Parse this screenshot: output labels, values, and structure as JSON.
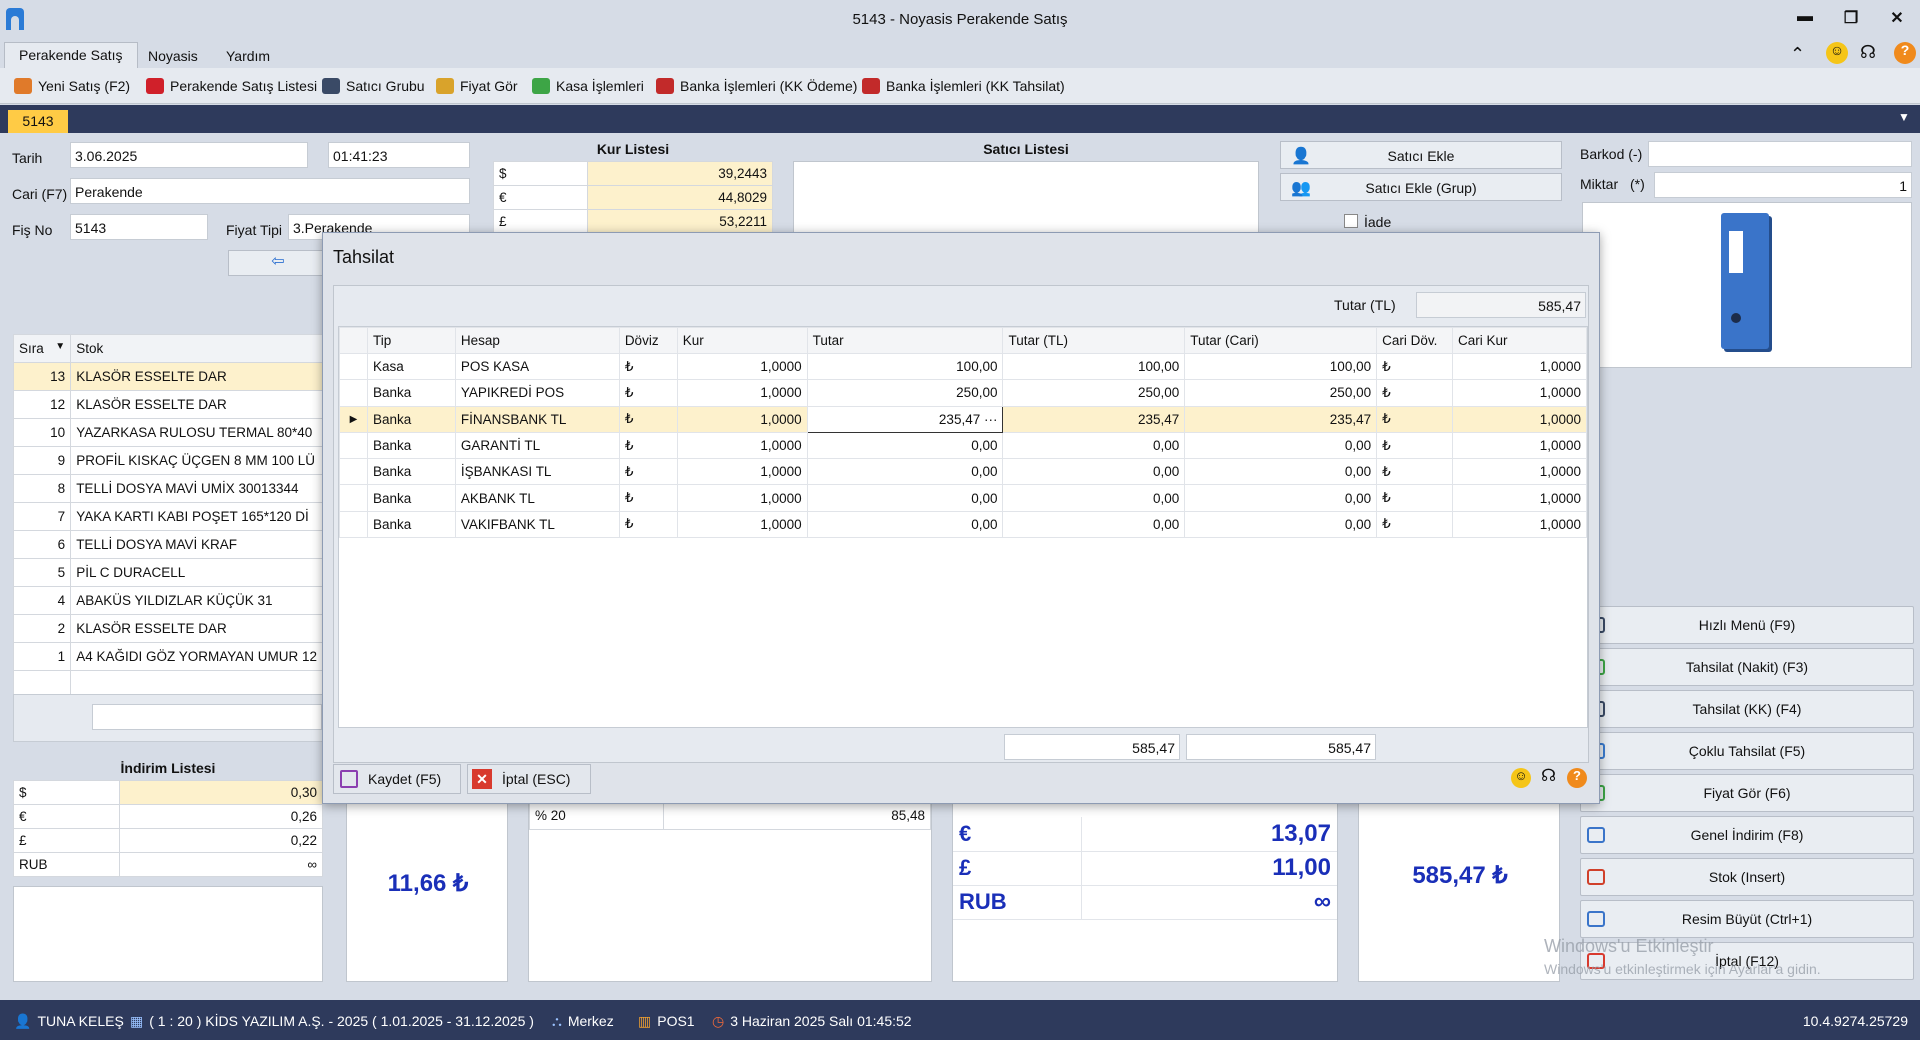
{
  "window": {
    "title": "5143 - Noyasis Perakende Satış",
    "minimize": "▬",
    "restore": "❐",
    "close": "✕"
  },
  "menu_tabs": [
    "Perakende Satış",
    "Noyasis",
    "Yardım"
  ],
  "ribbon": [
    {
      "label": "Yeni Satış (F2)",
      "icon": "new-sale-icon",
      "color": "#e07a2a"
    },
    {
      "label": "Perakende Satış Listesi",
      "icon": "cart-icon",
      "color": "#d0202a"
    },
    {
      "label": "Satıcı Grubu",
      "icon": "user-group-icon",
      "color": "#3a4a66"
    },
    {
      "label": "Fiyat Gör",
      "icon": "price-icon",
      "color": "#d9a32b"
    },
    {
      "label": "Kasa İşlemleri",
      "icon": "cash-icon",
      "color": "#3da546"
    },
    {
      "label": "Banka İşlemleri (KK Ödeme)",
      "icon": "card-icon",
      "color": "#c22a2a"
    },
    {
      "label": "Banka İşlemleri (KK Tahsilat)",
      "icon": "card-icon",
      "color": "#c22a2a"
    }
  ],
  "doc_tab": "5143",
  "form": {
    "tarih_label": "Tarih",
    "tarih": "3.06.2025",
    "saat": "01:41:23",
    "cari_label": "Cari (F7)",
    "cari": "Perakende",
    "fis_label": "Fiş No",
    "fis": "5143",
    "fiyat_tipi_label": "Fiyat Tipi",
    "fiyat_tipi": "3.Perakende"
  },
  "kur_listesi": {
    "title": "Kur Listesi",
    "rows": [
      [
        "$",
        "39,2443"
      ],
      [
        "€",
        "44,8029"
      ],
      [
        "£",
        "53,2211"
      ]
    ]
  },
  "satici_listesi": {
    "title": "Satıcı Listesi"
  },
  "satici_buttons": {
    "ekle": "Satıcı Ekle",
    "ekle_grup": "Satıcı Ekle (Grup)",
    "iade": "İade"
  },
  "barkod": {
    "label": "Barkod (-)",
    "value": ""
  },
  "miktar": {
    "label": "Miktar",
    "hint": "(*)",
    "value": "1"
  },
  "stock_table": {
    "headers": [
      "Sıra",
      "Stok"
    ],
    "rows": [
      [
        "13",
        "KLASÖR ESSELTE DAR"
      ],
      [
        "12",
        "KLASÖR ESSELTE DAR"
      ],
      [
        "10",
        "YAZARKASA RULOSU TERMAL 80*40"
      ],
      [
        "9",
        "PROFİL KISKAÇ ÜÇGEN 8 MM 100 LÜ"
      ],
      [
        "8",
        "TELLİ DOSYA MAVİ UMİX 30013344"
      ],
      [
        "7",
        "YAKA KARTI KABI POŞET 165*120 Dİ"
      ],
      [
        "6",
        "TELLİ DOSYA MAVİ KRAF"
      ],
      [
        "5",
        "PİL C DURACELL"
      ],
      [
        "4",
        "ABAKÜS YILDIZLAR KÜÇÜK 31"
      ],
      [
        "2",
        "KLASÖR ESSELTE DAR"
      ],
      [
        "1",
        "A4 KAĞIDI GÖZ YORMAYAN UMUR 12"
      ]
    ]
  },
  "indirim_listesi": {
    "title": "İndirim Listesi",
    "rows": [
      [
        "$",
        "0,30"
      ],
      [
        "€",
        "0,26"
      ],
      [
        "£",
        "0,22"
      ],
      [
        "RUB",
        "∞"
      ]
    ]
  },
  "totals": {
    "discount_total": "11,66 ₺",
    "kdv_row": [
      "% 20",
      "85,48"
    ],
    "currency_rows": [
      [
        "€",
        "13,07"
      ],
      [
        "£",
        "11,00"
      ],
      [
        "RUB",
        "∞"
      ]
    ],
    "grand_total": "585,47 ₺"
  },
  "right_buttons": [
    {
      "label": "Hızlı Menü (F9)",
      "icon": "menu-icon"
    },
    {
      "label": "Tahsilat (Nakit) (F3)",
      "icon": "cash-icon"
    },
    {
      "label": "Tahsilat (KK) (F4)",
      "icon": "card-icon"
    },
    {
      "label": "Çoklu Tahsilat (F5)",
      "icon": "multi-pay-icon"
    },
    {
      "label": "Fiyat Gör (F6)",
      "icon": "price-icon"
    },
    {
      "label": "Genel İndirim (F8)",
      "icon": "tag-icon"
    },
    {
      "label": "Stok (Insert)",
      "icon": "stock-icon"
    },
    {
      "label": "Resim Büyüt (Ctrl+1)",
      "icon": "zoom-icon"
    },
    {
      "label": "İptal (F12)",
      "icon": "cancel-icon"
    }
  ],
  "watermark": {
    "line1": "Windows'u Etkinleştir",
    "line2": "Windows'u etkinleştirmek için Ayarlar'a gidin."
  },
  "dialog": {
    "title": "Tahsilat",
    "tutar_tl_label": "Tutar (TL)",
    "tutar_tl": "585,47",
    "headers": [
      "Tip",
      "Hesap",
      "Döviz",
      "Kur",
      "Tutar",
      "Tutar (TL)",
      "Tutar (Cari)",
      "Cari Döv.",
      "Cari Kur"
    ],
    "rows": [
      [
        "Kasa",
        "POS KASA",
        "₺",
        "1,0000",
        "100,00",
        "100,00",
        "100,00",
        "₺",
        "1,0000"
      ],
      [
        "Banka",
        "YAPIKREDİ POS",
        "₺",
        "1,0000",
        "250,00",
        "250,00",
        "250,00",
        "₺",
        "1,0000"
      ],
      [
        "Banka",
        "FİNANSBANK TL",
        "₺",
        "1,0000",
        "235,47",
        "235,47",
        "235,47",
        "₺",
        "1,0000"
      ],
      [
        "Banka",
        "GARANTİ TL",
        "₺",
        "1,0000",
        "0,00",
        "0,00",
        "0,00",
        "₺",
        "1,0000"
      ],
      [
        "Banka",
        "İŞBANKASI TL",
        "₺",
        "1,0000",
        "0,00",
        "0,00",
        "0,00",
        "₺",
        "1,0000"
      ],
      [
        "Banka",
        "AKBANK TL",
        "₺",
        "1,0000",
        "0,00",
        "0,00",
        "0,00",
        "₺",
        "1,0000"
      ],
      [
        "Banka",
        "VAKIFBANK TL",
        "₺",
        "1,0000",
        "0,00",
        "0,00",
        "0,00",
        "₺",
        "1,0000"
      ]
    ],
    "footer_totals": [
      "585,47",
      "585,47"
    ],
    "kaydet": "Kaydet (F5)",
    "iptal": "İptal (ESC)"
  },
  "statusbar": {
    "user": "TUNA KELEŞ",
    "company": "( 1 : 20 )  KİDS YAZILIM A.Ş. - 2025  ( 1.01.2025 - 31.12.2025 )",
    "branch": "Merkez",
    "pos": "POS1",
    "datetime": "3 Haziran 2025 Salı 01:45:52",
    "version": "10.4.9274.25729"
  }
}
